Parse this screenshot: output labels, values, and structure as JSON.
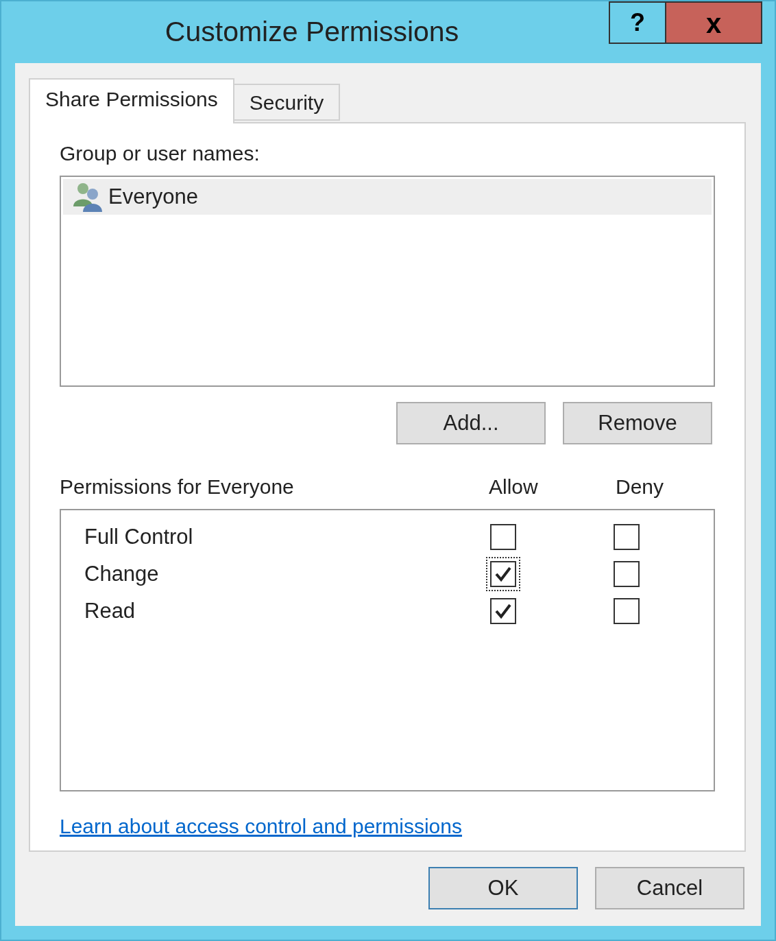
{
  "window": {
    "title": "Customize Permissions",
    "help_button": "?",
    "close_button": "x"
  },
  "tabs": [
    {
      "label": "Share Permissions",
      "selected": true
    },
    {
      "label": "Security",
      "selected": false
    }
  ],
  "group_label": "Group or user names:",
  "users": [
    {
      "name": "Everyone",
      "selected": true
    }
  ],
  "user_buttons": [
    "Add...",
    "Remove"
  ],
  "permissions_header": {
    "label": "Permissions for Everyone",
    "allow": "Allow",
    "deny": "Deny"
  },
  "permissions": [
    {
      "name": "Full Control",
      "allow": {
        "checked": false,
        "focused": false
      },
      "deny": {
        "checked": false,
        "focused": false
      }
    },
    {
      "name": "Change",
      "allow": {
        "checked": true,
        "focused": true
      },
      "deny": {
        "checked": false,
        "focused": false
      }
    },
    {
      "name": "Read",
      "allow": {
        "checked": true,
        "focused": false
      },
      "deny": {
        "checked": false,
        "focused": false
      }
    }
  ],
  "link": "Learn about access control and permissions",
  "buttons": [
    {
      "label": "OK",
      "default": true
    },
    {
      "label": "Cancel",
      "default": false
    }
  ]
}
